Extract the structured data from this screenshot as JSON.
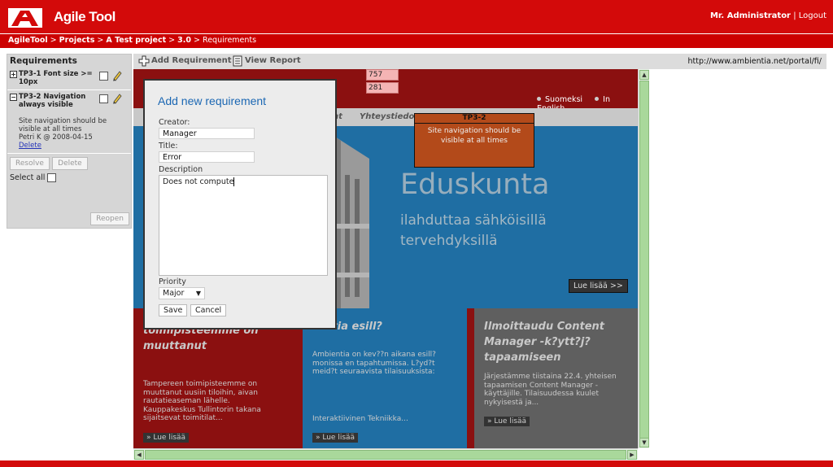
{
  "header": {
    "app_title": "Agile Tool",
    "user": "Mr. Administrator",
    "separator": "|",
    "logout": "Logout"
  },
  "breadcrumb": {
    "items": [
      "AgileTool",
      "Projects",
      "A Test project",
      "3.0"
    ],
    "sep": ">",
    "current": "Requirements"
  },
  "sidebar": {
    "title": "Requirements",
    "items": [
      {
        "expander": "+",
        "title": "TP3-1 Font size >= 10px"
      },
      {
        "expander": "−",
        "title": "TP3-2 Navigation always visible",
        "detail_text": "Site navigation should be visible at all times",
        "detail_meta": "Petri K @ 2008-04-15",
        "detail_link": "Delete"
      }
    ],
    "resolve": "Resolve",
    "delete": "Delete",
    "select_all": "Select all",
    "reopen": "Reopen"
  },
  "toolbar": {
    "add_requirement": "Add Requirement",
    "view_report": "View Report",
    "url": "http://www.ambientia.net/portal/fi/"
  },
  "preview": {
    "lang_fi": "Suomeksi",
    "lang_en": "In English",
    "nav_item_partial": "nt",
    "nav_contacts": "Yhteystiedot",
    "hero_title": "Eduskunta",
    "hero_sub1": "ilahduttaa sähköisillä",
    "hero_sub2": "tervehdyksillä",
    "hero_button": "Lue lisää >>",
    "col1_title": "toimipisteemme on muuttanut",
    "col1_text": "Tampereen toimipisteemme on muuttanut uusiin tiloihin, aivan rautatieaseman lähelle. Kauppakeskus Tullintorin takana sijaitsevat toimitilat...",
    "col1_btn": "» Lue lisää",
    "col2_title": "ientia esill?",
    "col2_text": "Ambientia on kev??n aikana esill? monissa en tapahtumissa. L?yd?t meid?t seuraavista tilaisuuksista:",
    "col2_extra": "Interaktiivinen Tekniikka...",
    "col2_btn": "» Lue lisää",
    "col3_title": "Ilmoittaudu Content Manager -k?ytt?j?tapaamiseen",
    "col3_text": "Järjestämme tiistaina 22.4. yhteisen tapaamisen Content Manager -käyttäjille. Tilaisuudessa kuulet nykyisestä ja...",
    "col3_btn": "» Lue lisää",
    "tp32_head": "TP3-2",
    "tp32_text": "Site navigation should be visible at all times",
    "pos_x": "757",
    "pos_y": "281"
  },
  "dialog": {
    "title": "Add new requirement",
    "creator_label": "Creator:",
    "creator_value": "Manager",
    "title_label": "Title:",
    "title_value": "Error",
    "desc_label": "Description",
    "desc_value": "Does not compute",
    "priority_label": "Priority",
    "priority_value": "Major",
    "save": "Save",
    "cancel": "Cancel"
  },
  "colors": {
    "brand_red": "#d30a0a",
    "link_blue": "#1b67b3",
    "scroll_green": "#a9d89b"
  },
  "icons": [
    "logo-icon",
    "pencil-icon",
    "add-icon",
    "report-icon",
    "chevron-down-icon"
  ]
}
